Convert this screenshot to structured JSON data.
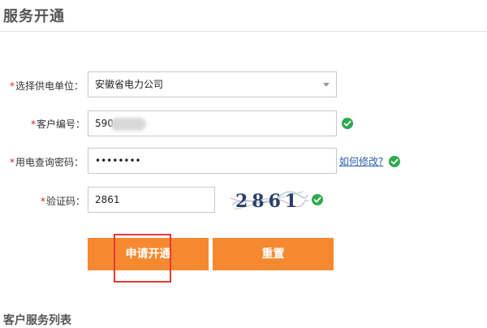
{
  "page": {
    "title": "服务开通",
    "list_title": "客户服务列表"
  },
  "form": {
    "required_mark": "*",
    "supplier": {
      "label": "选择供电单位：",
      "value": "安徽省电力公司"
    },
    "customer_no": {
      "label": "客户编号：",
      "value": "590"
    },
    "password": {
      "label": "用电查询密码：",
      "value": "••••••••",
      "help_link": "如何修改?"
    },
    "captcha": {
      "label": "验证码：",
      "value": "2861",
      "image_text": "2861"
    }
  },
  "buttons": {
    "apply": "申请开通",
    "reset": "重置"
  },
  "colors": {
    "button_bg": "#f6892f",
    "ok_green": "#2fa84f",
    "required_red": "#e02020",
    "highlight_red": "#e53935",
    "link_blue": "#2a5db0"
  }
}
